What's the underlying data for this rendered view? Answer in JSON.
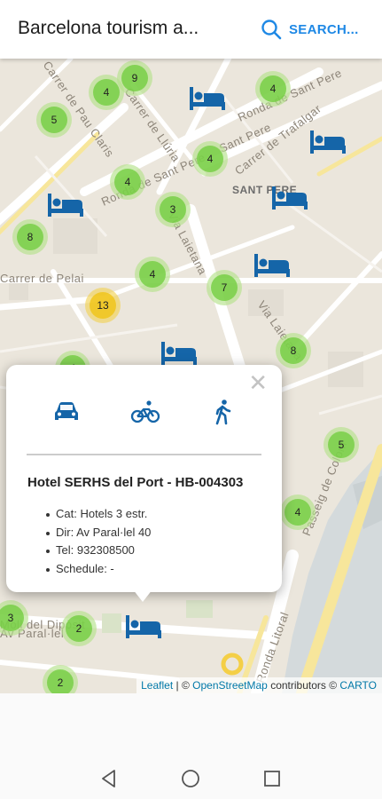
{
  "app_bar": {
    "title": "Barcelona tourism a...",
    "search_label": "SEARCH...",
    "accent_color": "#1e88e5"
  },
  "map": {
    "street_labels": [
      "Carrer de Pau Claris",
      "Carrer de Llúria",
      "Ronda de Sant Pere",
      "Sant Pere",
      "Ronda de Sant Pere",
      "Carrer de Trafalgar",
      "Via Laietana",
      "Via Laietana",
      "Carrer de Pelai",
      "Passeig de Colom",
      "Moll del Dipòsit",
      "Av Paral·lel",
      "Ronda Litoral"
    ],
    "area_labels": [
      "SANT PERE"
    ],
    "clusters": [
      "9",
      "4",
      "4",
      "5",
      "4",
      "4",
      "3",
      "8",
      "4",
      "7",
      "13",
      "8",
      "4",
      "5",
      "4",
      "3",
      "2",
      "2"
    ],
    "cluster_colors": {
      "small": "#6ecc39",
      "medium": "#f0c20c"
    },
    "hotel_icon": "bed-icon",
    "hotel_icon_color": "#1565a8"
  },
  "popup": {
    "close_label": "✕",
    "transport_modes": [
      "car-icon",
      "bicycle-icon",
      "walking-icon"
    ],
    "title": "Hotel SERHS del Port - HB-004303",
    "details": [
      "Cat: Hotels 3 estr.",
      "Dir: Av Paral·lel 40",
      "Tel: 932308500",
      "Schedule: -"
    ]
  },
  "attribution": {
    "leaflet": "Leaflet",
    "separator": "| ©",
    "osm": "OpenStreetMap",
    "contributors": "contributors ©",
    "carto": "CARTO"
  },
  "system_nav": [
    "back-icon",
    "home-icon",
    "recents-icon"
  ]
}
